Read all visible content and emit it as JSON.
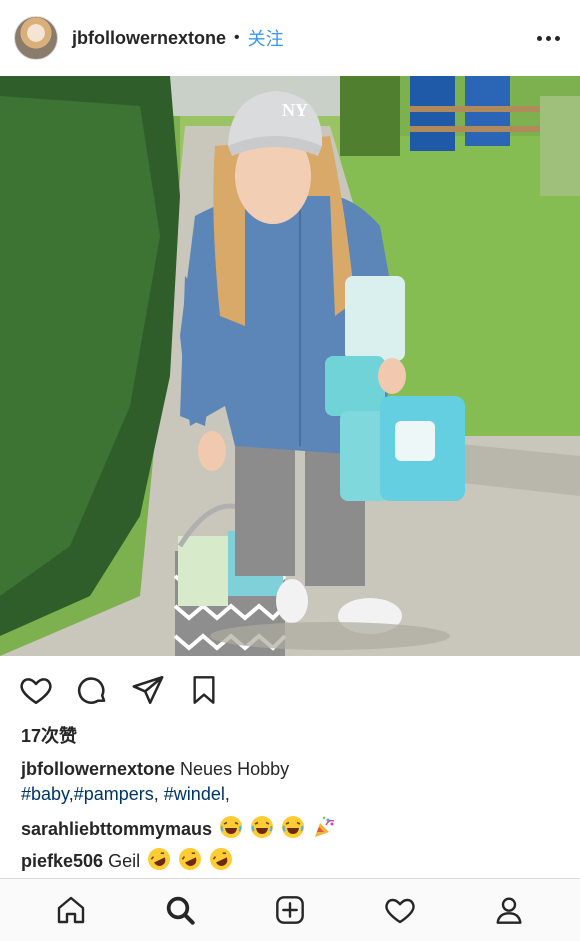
{
  "header": {
    "username": "jbfollowernextone",
    "separator": "•",
    "follow_label": "关注"
  },
  "post": {
    "likes_text": "17次赞",
    "caption": {
      "username": "jbfollowernextone",
      "text": "Neues Hobby",
      "tags": [
        "#baby",
        "#pampers",
        "#windel"
      ],
      "tag_sep_1": ",",
      "tag_sep_2": ", ",
      "tag_sep_3": ","
    },
    "comments": [
      {
        "username": "sarahliebttommymaus",
        "text": "",
        "emojis": [
          "laughing",
          "laughing",
          "laughing",
          "party-popper"
        ]
      },
      {
        "username": "piefke506",
        "text": "Geil",
        "emojis": [
          "rofl",
          "rofl",
          "rofl"
        ]
      }
    ]
  },
  "bottom_nav": {
    "items": [
      "home-icon",
      "search-icon",
      "new-post-icon",
      "activity-icon",
      "profile-icon"
    ]
  },
  "colors": {
    "link_blue": "#3897f0",
    "hashtag_navy": "#003569",
    "text": "#262626",
    "divider": "#dbdbdb"
  }
}
